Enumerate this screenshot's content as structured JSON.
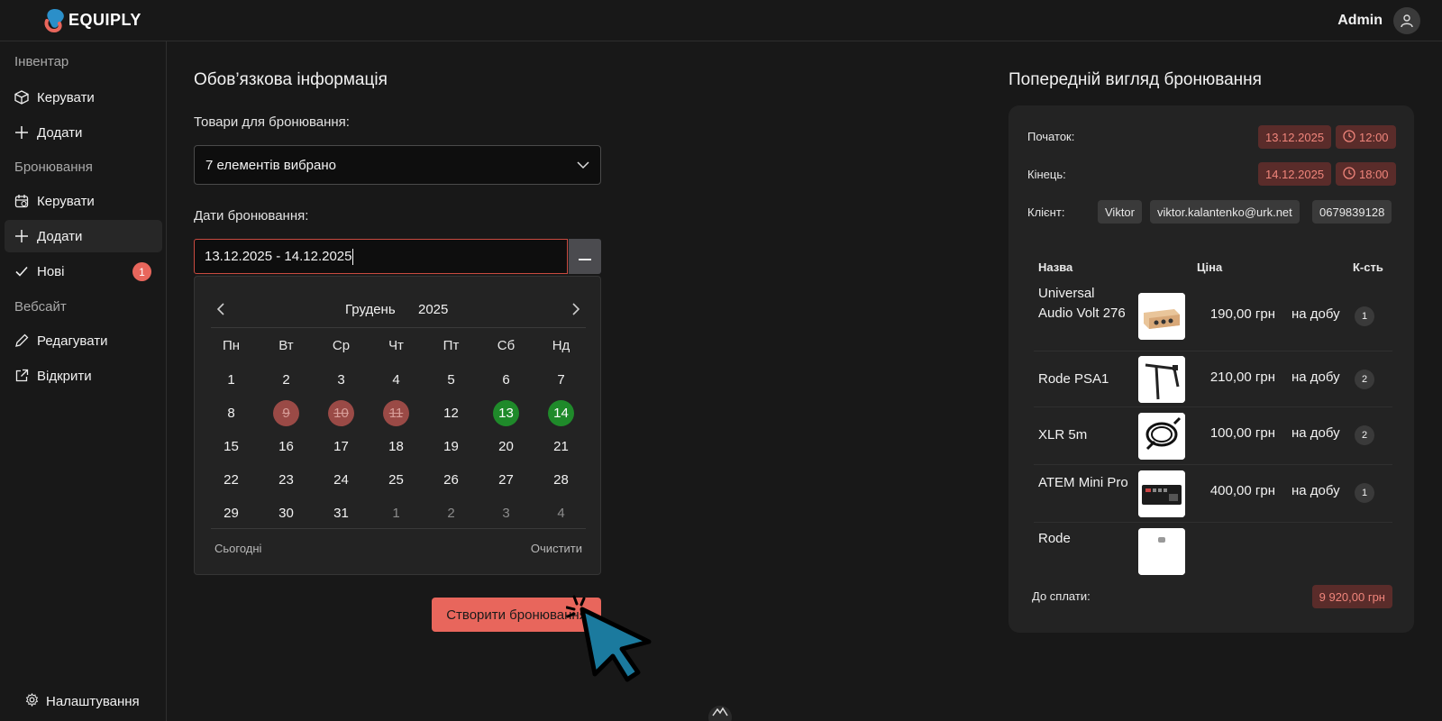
{
  "brand": {
    "name": "EQUIPLY"
  },
  "header": {
    "user_name": "Admin"
  },
  "sidebar": {
    "sections": [
      {
        "title": "Інвентар",
        "items": [
          {
            "label": "Керувати",
            "icon": "box-icon"
          },
          {
            "label": "Додати",
            "icon": "plus-icon"
          }
        ]
      },
      {
        "title": "Бронювання",
        "items": [
          {
            "label": "Керувати",
            "icon": "calendar-icon"
          },
          {
            "label": "Додати",
            "icon": "plus-icon",
            "active": true
          },
          {
            "label": "Нові",
            "icon": "check-icon",
            "badge": "1"
          }
        ]
      },
      {
        "title": "Вебсайт",
        "items": [
          {
            "label": "Редагувати",
            "icon": "pencil-icon"
          },
          {
            "label": "Відкрити",
            "icon": "external-link-icon"
          }
        ]
      }
    ],
    "settings_label": "Налаштування"
  },
  "form": {
    "title": "Обов’язкова інформація",
    "items_label": "Товари для бронювання:",
    "items_value": "7 елементів вибрано",
    "dates_label": "Дати бронювання:",
    "dates_value": "13.12.2025 - 14.12.2025",
    "submit_label": "Створити бронювання"
  },
  "calendar": {
    "month": "Грудень",
    "year": "2025",
    "weekdays": [
      "Пн",
      "Вт",
      "Ср",
      "Чт",
      "Пт",
      "Сб",
      "Нд"
    ],
    "days": [
      {
        "d": "1"
      },
      {
        "d": "2"
      },
      {
        "d": "3"
      },
      {
        "d": "4"
      },
      {
        "d": "5"
      },
      {
        "d": "6"
      },
      {
        "d": "7"
      },
      {
        "d": "8"
      },
      {
        "d": "9",
        "state": "booked"
      },
      {
        "d": "10",
        "state": "booked"
      },
      {
        "d": "11",
        "state": "booked"
      },
      {
        "d": "12"
      },
      {
        "d": "13",
        "state": "selected"
      },
      {
        "d": "14",
        "state": "selected"
      },
      {
        "d": "15"
      },
      {
        "d": "16"
      },
      {
        "d": "17"
      },
      {
        "d": "18"
      },
      {
        "d": "19"
      },
      {
        "d": "20"
      },
      {
        "d": "21"
      },
      {
        "d": "22"
      },
      {
        "d": "23"
      },
      {
        "d": "24"
      },
      {
        "d": "25"
      },
      {
        "d": "26"
      },
      {
        "d": "27"
      },
      {
        "d": "28"
      },
      {
        "d": "29"
      },
      {
        "d": "30"
      },
      {
        "d": "31"
      },
      {
        "d": "1",
        "state": "muted"
      },
      {
        "d": "2",
        "state": "muted"
      },
      {
        "d": "3",
        "state": "muted"
      },
      {
        "d": "4",
        "state": "muted"
      }
    ],
    "today_label": "Сьогодні",
    "clear_label": "Очистити"
  },
  "preview": {
    "title": "Попередній вигляд бронювання",
    "start_label": "Початок:",
    "start_date": "13.12.2025",
    "start_time": "12:00",
    "end_label": "Кінець:",
    "end_date": "14.12.2025",
    "end_time": "18:00",
    "client_label": "Клієнт:",
    "client_name": "Viktor",
    "client_email": "viktor.kalantenko@urk.net",
    "client_phone": "0679839128",
    "col_name": "Назва",
    "col_price": "Ціна",
    "col_qty": "К-сть",
    "items": [
      {
        "name": "Universal Audio Volt 276",
        "price": "190,00 грн",
        "per": "на добу",
        "qty": "1",
        "thumb": "audio-interface"
      },
      {
        "name": "Rode PSA1",
        "price": "210,00 грн",
        "per": "на добу",
        "qty": "2",
        "thumb": "boom-arm"
      },
      {
        "name": "XLR 5m",
        "price": "100,00 грн",
        "per": "на добу",
        "qty": "2",
        "thumb": "cable"
      },
      {
        "name": "ATEM Mini Pro",
        "price": "400,00 грн",
        "per": "на добу",
        "qty": "1",
        "thumb": "switcher"
      },
      {
        "name": "Rode",
        "price": "",
        "per": "",
        "qty": "",
        "thumb": "mic"
      }
    ],
    "total_label": "До сплати:",
    "total_value": "9 920,00 грн"
  },
  "colors": {
    "accent": "#e8665c",
    "selected_day": "#1f8a2a",
    "booked_day": "#9a4a46",
    "card_bg": "#232323",
    "page_bg": "#181818"
  }
}
